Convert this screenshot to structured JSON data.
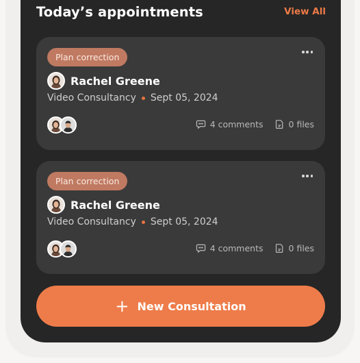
{
  "header": {
    "title": "Today’s appointments",
    "view_all": "View All"
  },
  "appointments": [
    {
      "status": "Plan correction",
      "name": "Rachel Greene",
      "type": "Video Consultancy",
      "date": "Sept 05, 2024",
      "comments": "4 comments",
      "files": "0 files"
    },
    {
      "status": "Plan correction",
      "name": "Rachel Greene",
      "type": "Video Consultancy",
      "date": "Sept 05, 2024",
      "comments": "4 comments",
      "files": "0 files"
    }
  ],
  "cta": {
    "icon": "plus-icon",
    "label": "New Consultation"
  },
  "colors": {
    "accent": "#ee7c4a",
    "badge": "#c07a62",
    "panel": "#262626",
    "card": "#3a3a3a"
  }
}
